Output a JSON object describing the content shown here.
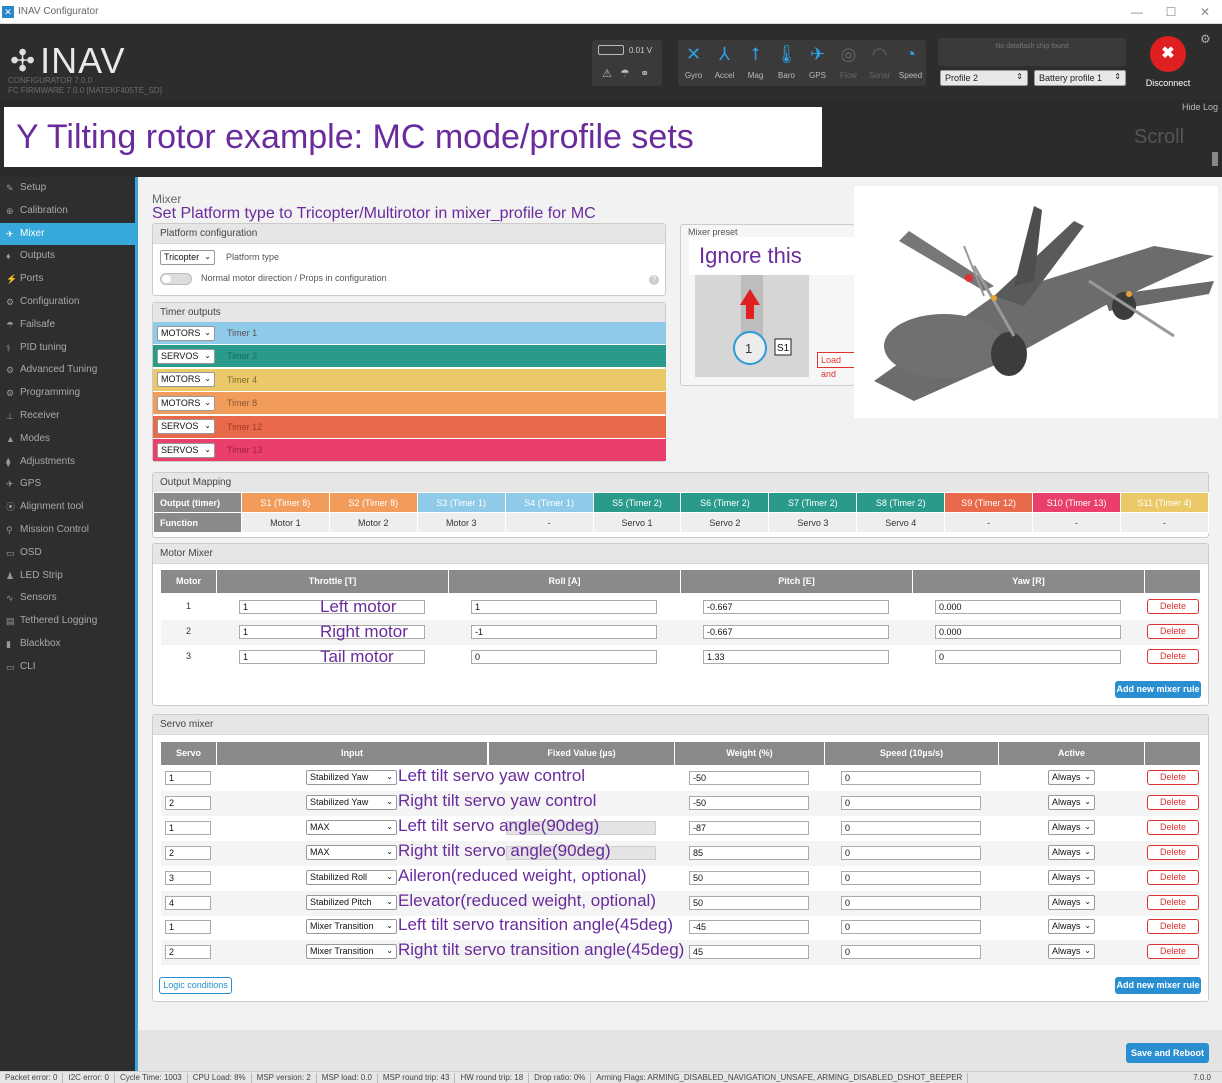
{
  "window": {
    "title": "INAV Configurator",
    "controls": [
      "—",
      "☐",
      "✕"
    ]
  },
  "header": {
    "logo": "INAV",
    "configurator": "CONFIGURATOR  7.0.0",
    "firmware": "FC FIRMWARE     7.0.0 [MATEKF405TE_SD]",
    "battery_voltage": "0.01 V",
    "sensors": [
      {
        "label": "Gyro",
        "icon": "gyro-icon",
        "glyph": "✕",
        "on": true
      },
      {
        "label": "Accel",
        "icon": "accel-icon",
        "glyph": "⅄",
        "on": true
      },
      {
        "label": "Mag",
        "icon": "mag-icon",
        "glyph": "⭡",
        "on": true
      },
      {
        "label": "Baro",
        "icon": "baro-icon",
        "glyph": "🌡",
        "on": true
      },
      {
        "label": "GPS",
        "icon": "gps-icon",
        "glyph": "✈",
        "on": true
      },
      {
        "label": "Flow",
        "icon": "flow-icon",
        "glyph": "◎",
        "on": false
      },
      {
        "label": "Sonar",
        "icon": "sonar-icon",
        "glyph": "◠",
        "on": false
      },
      {
        "label": "Speed",
        "icon": "speed-icon",
        "glyph": "◔",
        "on": true
      }
    ],
    "dataflash": "No dataflash chip found",
    "profile": "Profile 2",
    "battery_profile": "Battery profile 1",
    "disconnect": "Disconnect",
    "hide_log": "Hide Log",
    "scroll": "Scroll"
  },
  "banner": "Y Tilting rotor example: MC mode/profile sets",
  "sidebar": [
    {
      "label": "Setup",
      "icon": "wrench-icon",
      "glyph": "✎"
    },
    {
      "label": "Calibration",
      "icon": "crosshair-icon",
      "glyph": "⊕"
    },
    {
      "label": "Mixer",
      "icon": "mixer-icon",
      "glyph": "✈",
      "active": true
    },
    {
      "label": "Outputs",
      "icon": "outputs-icon",
      "glyph": "♦"
    },
    {
      "label": "Ports",
      "icon": "ports-icon",
      "glyph": "⚡"
    },
    {
      "label": "Configuration",
      "icon": "gear-icon",
      "glyph": "⚙"
    },
    {
      "label": "Failsafe",
      "icon": "parachute-icon",
      "glyph": "☂"
    },
    {
      "label": "PID tuning",
      "icon": "pid-icon",
      "glyph": "⚕"
    },
    {
      "label": "Advanced Tuning",
      "icon": "gear-icon",
      "glyph": "⚙"
    },
    {
      "label": "Programming",
      "icon": "gear-icon",
      "glyph": "⚙"
    },
    {
      "label": "Receiver",
      "icon": "receiver-icon",
      "glyph": "⊥"
    },
    {
      "label": "Modes",
      "icon": "modes-icon",
      "glyph": "▲"
    },
    {
      "label": "Adjustments",
      "icon": "adjust-icon",
      "glyph": "⧫"
    },
    {
      "label": "GPS",
      "icon": "satellite-icon",
      "glyph": "✈"
    },
    {
      "label": "Alignment tool",
      "icon": "align-icon",
      "glyph": "⦿"
    },
    {
      "label": "Mission Control",
      "icon": "pin-icon",
      "glyph": "⚲"
    },
    {
      "label": "OSD",
      "icon": "osd-icon",
      "glyph": "▭"
    },
    {
      "label": "LED Strip",
      "icon": "led-icon",
      "glyph": "♟"
    },
    {
      "label": "Sensors",
      "icon": "sensor-icon",
      "glyph": "∿"
    },
    {
      "label": "Tethered Logging",
      "icon": "log-icon",
      "glyph": "▤"
    },
    {
      "label": "Blackbox",
      "icon": "blackbox-icon",
      "glyph": "▮"
    },
    {
      "label": "CLI",
      "icon": "cli-icon",
      "glyph": "▭"
    }
  ],
  "mixer": {
    "title": "Mixer",
    "annotation_platform": "Set Platform type to Tricopter/Multirotor in mixer_profile for MC",
    "platform_header": "Platform configuration",
    "platform_type_value": "Tricopter",
    "platform_type_label": "Platform type",
    "motor_direction_label": "Normal motor direction / Props in configuration",
    "ignore_note": "Ignore this",
    "preset_header": "Mixer preset",
    "preset_load": "Load and",
    "timer_header": "Timer outputs",
    "timers": [
      {
        "mode": "MOTORS",
        "name": "Timer 1",
        "color": "#8fcbe8",
        "text": "#555"
      },
      {
        "mode": "SERVOS",
        "name": "Timer 2",
        "color": "#2a9a8a",
        "text": "#1b6b60"
      },
      {
        "mode": "MOTORS",
        "name": "Timer 4",
        "color": "#ecc968",
        "text": "#7a6a30"
      },
      {
        "mode": "MOTORS",
        "name": "Timer 8",
        "color": "#f29c5c",
        "text": "#8a5530"
      },
      {
        "mode": "SERVOS",
        "name": "Timer 12",
        "color": "#e96a4a",
        "text": "#9a3a28"
      },
      {
        "mode": "SERVOS",
        "name": "Timer 13",
        "color": "#ea3f6a",
        "text": "#a02040"
      }
    ],
    "output_header": "Output Mapping",
    "output_label": "Output (timer)",
    "function_label": "Function",
    "outputs": [
      {
        "name": "S1 (Timer 8)",
        "fn": "Motor 1",
        "color": "#f29c5c"
      },
      {
        "name": "S2 (Timer 8)",
        "fn": "Motor 2",
        "color": "#f29c5c"
      },
      {
        "name": "S3 (Timer 1)",
        "fn": "Motor 3",
        "color": "#8fcbe8"
      },
      {
        "name": "S4 (Timer 1)",
        "fn": "-",
        "color": "#8fcbe8"
      },
      {
        "name": "S5 (Timer 2)",
        "fn": "Servo 1",
        "color": "#2a9a8a"
      },
      {
        "name": "S6 (Timer 2)",
        "fn": "Servo 2",
        "color": "#2a9a8a"
      },
      {
        "name": "S7 (Timer 2)",
        "fn": "Servo 3",
        "color": "#2a9a8a"
      },
      {
        "name": "S8 (Timer 2)",
        "fn": "Servo 4",
        "color": "#2a9a8a"
      },
      {
        "name": "S9 (Timer 12)",
        "fn": "-",
        "color": "#e96a4a"
      },
      {
        "name": "S10 (Timer 13)",
        "fn": "-",
        "color": "#ea3f6a"
      },
      {
        "name": "S11 (Timer 4)",
        "fn": "-",
        "color": "#ecc968"
      }
    ],
    "motor_header": "Motor Mixer",
    "motor_cols": [
      "Motor",
      "Throttle [T]",
      "Roll [A]",
      "Pitch [E]",
      "Yaw [R]"
    ],
    "motors": [
      {
        "n": "1",
        "thr": "1",
        "note": "Left motor",
        "roll": "1",
        "pitch": "-0.667",
        "yaw": "0.000"
      },
      {
        "n": "2",
        "thr": "1",
        "note": "Right motor",
        "roll": "-1",
        "pitch": "-0.667",
        "yaw": "0.000"
      },
      {
        "n": "3",
        "thr": "1",
        "note": "Tail motor",
        "roll": "0",
        "pitch": "1.33",
        "yaw": "0"
      }
    ],
    "delete": "Delete",
    "add_rule": "Add new mixer rule",
    "servo_header": "Servo mixer",
    "servo_cols": [
      "Servo",
      "Input",
      "Fixed Value (µs)",
      "Weight (%)",
      "Speed (10µs/s)",
      "Active"
    ],
    "servos": [
      {
        "servo": "1",
        "input": "Stabilized Yaw",
        "note": "Left tilt servo yaw control",
        "weight": "-50",
        "speed": "0",
        "active": "Always"
      },
      {
        "servo": "2",
        "input": "Stabilized Yaw",
        "note": "Right tilt servo yaw control",
        "weight": "-50",
        "speed": "0",
        "active": "Always"
      },
      {
        "servo": "1",
        "input": "MAX",
        "note": "Left tilt servo angle(90deg)",
        "weight": "-87",
        "speed": "0",
        "active": "Always"
      },
      {
        "servo": "2",
        "input": "MAX",
        "note": "Right tilt servo angle(90deg)",
        "weight": "85",
        "speed": "0",
        "active": "Always"
      },
      {
        "servo": "3",
        "input": "Stabilized Roll",
        "note": "Aileron(reduced weight, optional)",
        "weight": "50",
        "speed": "0",
        "active": "Always"
      },
      {
        "servo": "4",
        "input": "Stabilized Pitch",
        "note": "Elevator(reduced weight, optional)",
        "weight": "50",
        "speed": "0",
        "active": "Always"
      },
      {
        "servo": "1",
        "input": "Mixer Transition",
        "note": "Left tilt servo transition angle(45deg)",
        "weight": "-45",
        "speed": "0",
        "active": "Always"
      },
      {
        "servo": "2",
        "input": "Mixer Transition",
        "note": "Right tilt servo transition angle(45deg)",
        "weight": "45",
        "speed": "0",
        "active": "Always"
      }
    ],
    "logic_conditions": "Logic conditions",
    "save_reboot": "Save and Reboot"
  },
  "status": [
    "Packet error: 0",
    "I2C error: 0",
    "Cycle Time: 1003",
    "CPU Load: 8%",
    "MSP version: 2",
    "MSP load: 0.0",
    "MSP round trip: 43",
    "HW round trip: 18",
    "Drop ratio: 0%",
    "Arming Flags: ARMING_DISABLED_NAVIGATION_UNSAFE, ARMING_DISABLED_DSHOT_BEEPER"
  ],
  "version": "7.0.0"
}
